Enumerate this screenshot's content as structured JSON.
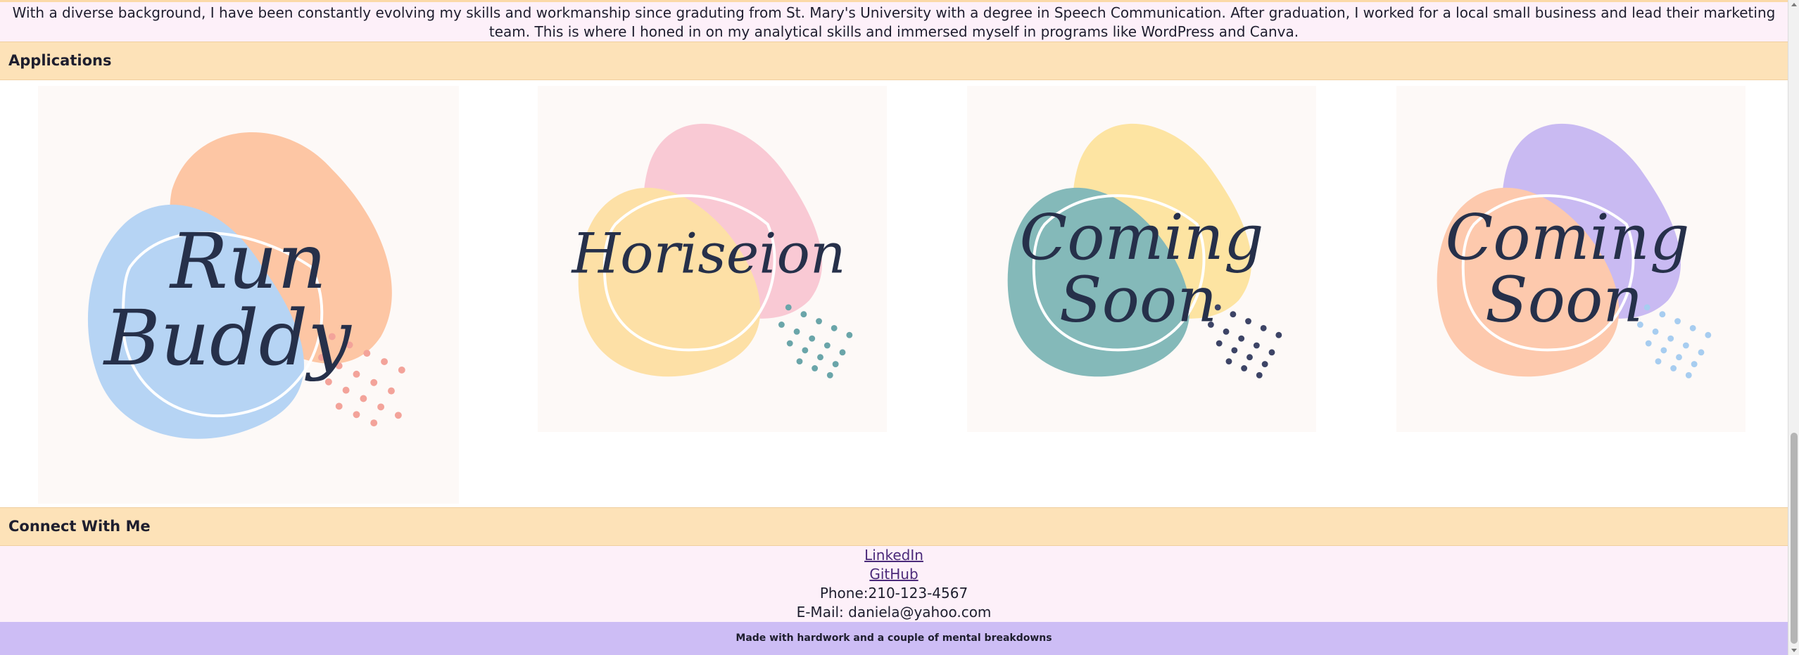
{
  "about": {
    "text": "With a diverse background, I have been constantly evolving my skills and workmanship since graduting from St. Mary's University with a degree in Speech Communication. After graduation, I worked for a local small business and lead their marketing team. This is where I honed in on my analytical skills and immersed myself in programs like WordPress and Canva."
  },
  "applications": {
    "heading": "Applications",
    "items": [
      {
        "line1": "Run",
        "line2": "Buddy",
        "colors": {
          "back": "#fdc6a4",
          "front": "#b6d4f4",
          "dots": "#f3a39a"
        }
      },
      {
        "line1": "Horiseion",
        "line2": "",
        "colors": {
          "back": "#f9c9d4",
          "front": "#fde0a6",
          "dots": "#6aa5a9"
        }
      },
      {
        "line1": "Coming",
        "line2": "Soon",
        "colors": {
          "back": "#fde4a2",
          "front": "#84b9b9",
          "dots": "#3d4466"
        }
      },
      {
        "line1": "Coming",
        "line2": "Soon",
        "colors": {
          "back": "#c9baf2",
          "front": "#fdc9ad",
          "dots": "#a7cdf0"
        }
      }
    ]
  },
  "connect": {
    "heading": "Connect With Me",
    "linkedin": "LinkedIn",
    "github": "GitHub",
    "phone": "Phone:210-123-4567",
    "email": "E-Mail: daniela@yahoo.com"
  },
  "footer": {
    "text": "Made with hardwork and a couple of mental breakdowns"
  },
  "theme": {
    "header_bg": "#fde2b8",
    "page_bg": "#fdf0f9",
    "footer_bg": "#cdbdf5"
  }
}
